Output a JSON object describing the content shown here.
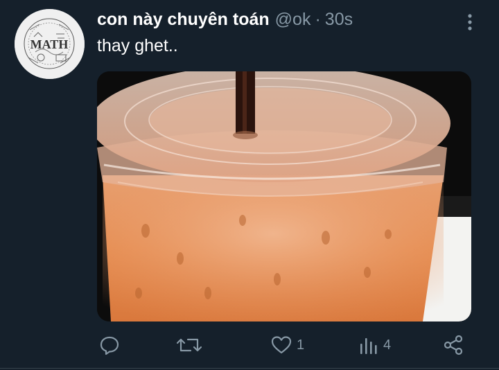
{
  "tweet": {
    "display_name": "con này chuyên toán",
    "handle": "@ok",
    "separator": "·",
    "timestamp": "30s",
    "text": "thay ghet..",
    "avatar_text": "MATH"
  },
  "actions": {
    "reply_icon": "reply-icon",
    "retweet_icon": "retweet-icon",
    "like_icon": "heart-icon",
    "like_count": "1",
    "analytics_icon": "analytics-icon",
    "analytics_count": "4",
    "share_icon": "share-icon"
  },
  "colors": {
    "background": "#15202b",
    "secondary_text": "#8899a6",
    "primary_text": "#ffffff"
  }
}
